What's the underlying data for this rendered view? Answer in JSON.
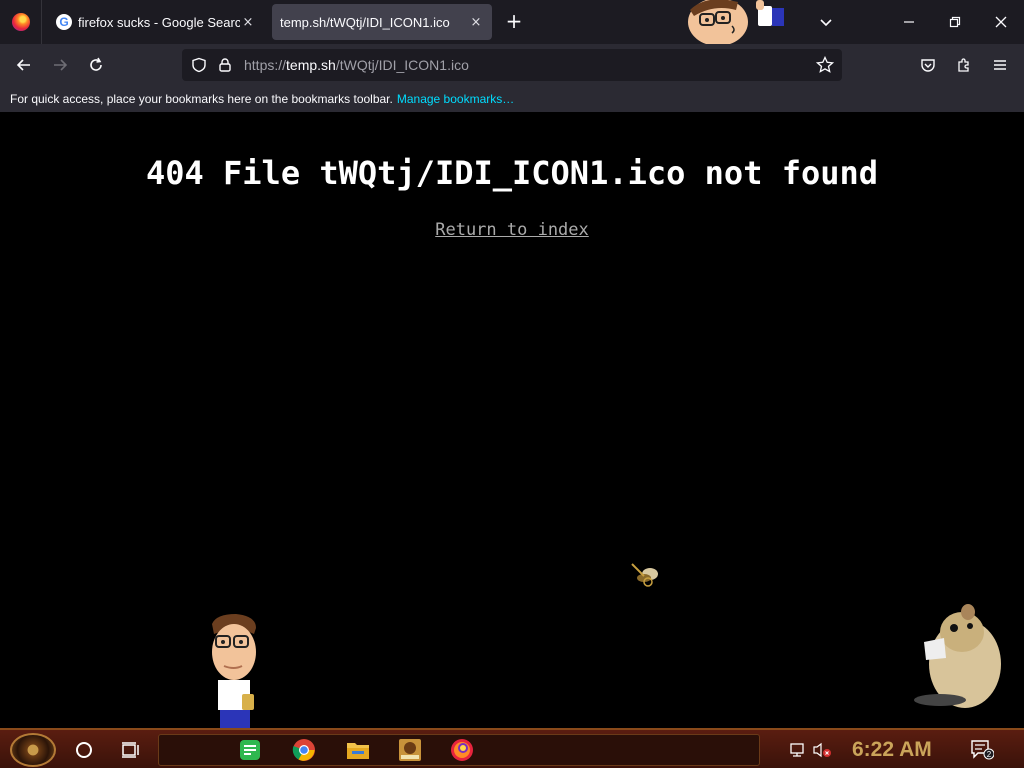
{
  "tabs": [
    {
      "title": "firefox sucks - Google Search",
      "close": "×"
    },
    {
      "title": "temp.sh/tWQtj/IDI_ICON1.ico",
      "close": "×"
    }
  ],
  "newtab_label": "+",
  "nav": {
    "url_prefix": "https://",
    "url_host": "temp.sh",
    "url_path": "/tWQtj/IDI_ICON1.ico"
  },
  "bookmarks_bar": {
    "message": "For quick access, place your bookmarks here on the bookmarks toolbar.",
    "manage_link": "Manage bookmarks…"
  },
  "page": {
    "error_title": "404 File tWQtj/IDI_ICON1.ico not found",
    "return_link": "Return to index"
  },
  "taskbar": {
    "clock": "6:22 AM",
    "notification_count": "2"
  },
  "colors": {
    "tab_bg": "#1c1b22",
    "active_tab": "#42414d",
    "toolbar": "#2b2a33",
    "link_accent": "#00ddff",
    "taskbar": "#4a170c",
    "clock": "#caa45a"
  }
}
